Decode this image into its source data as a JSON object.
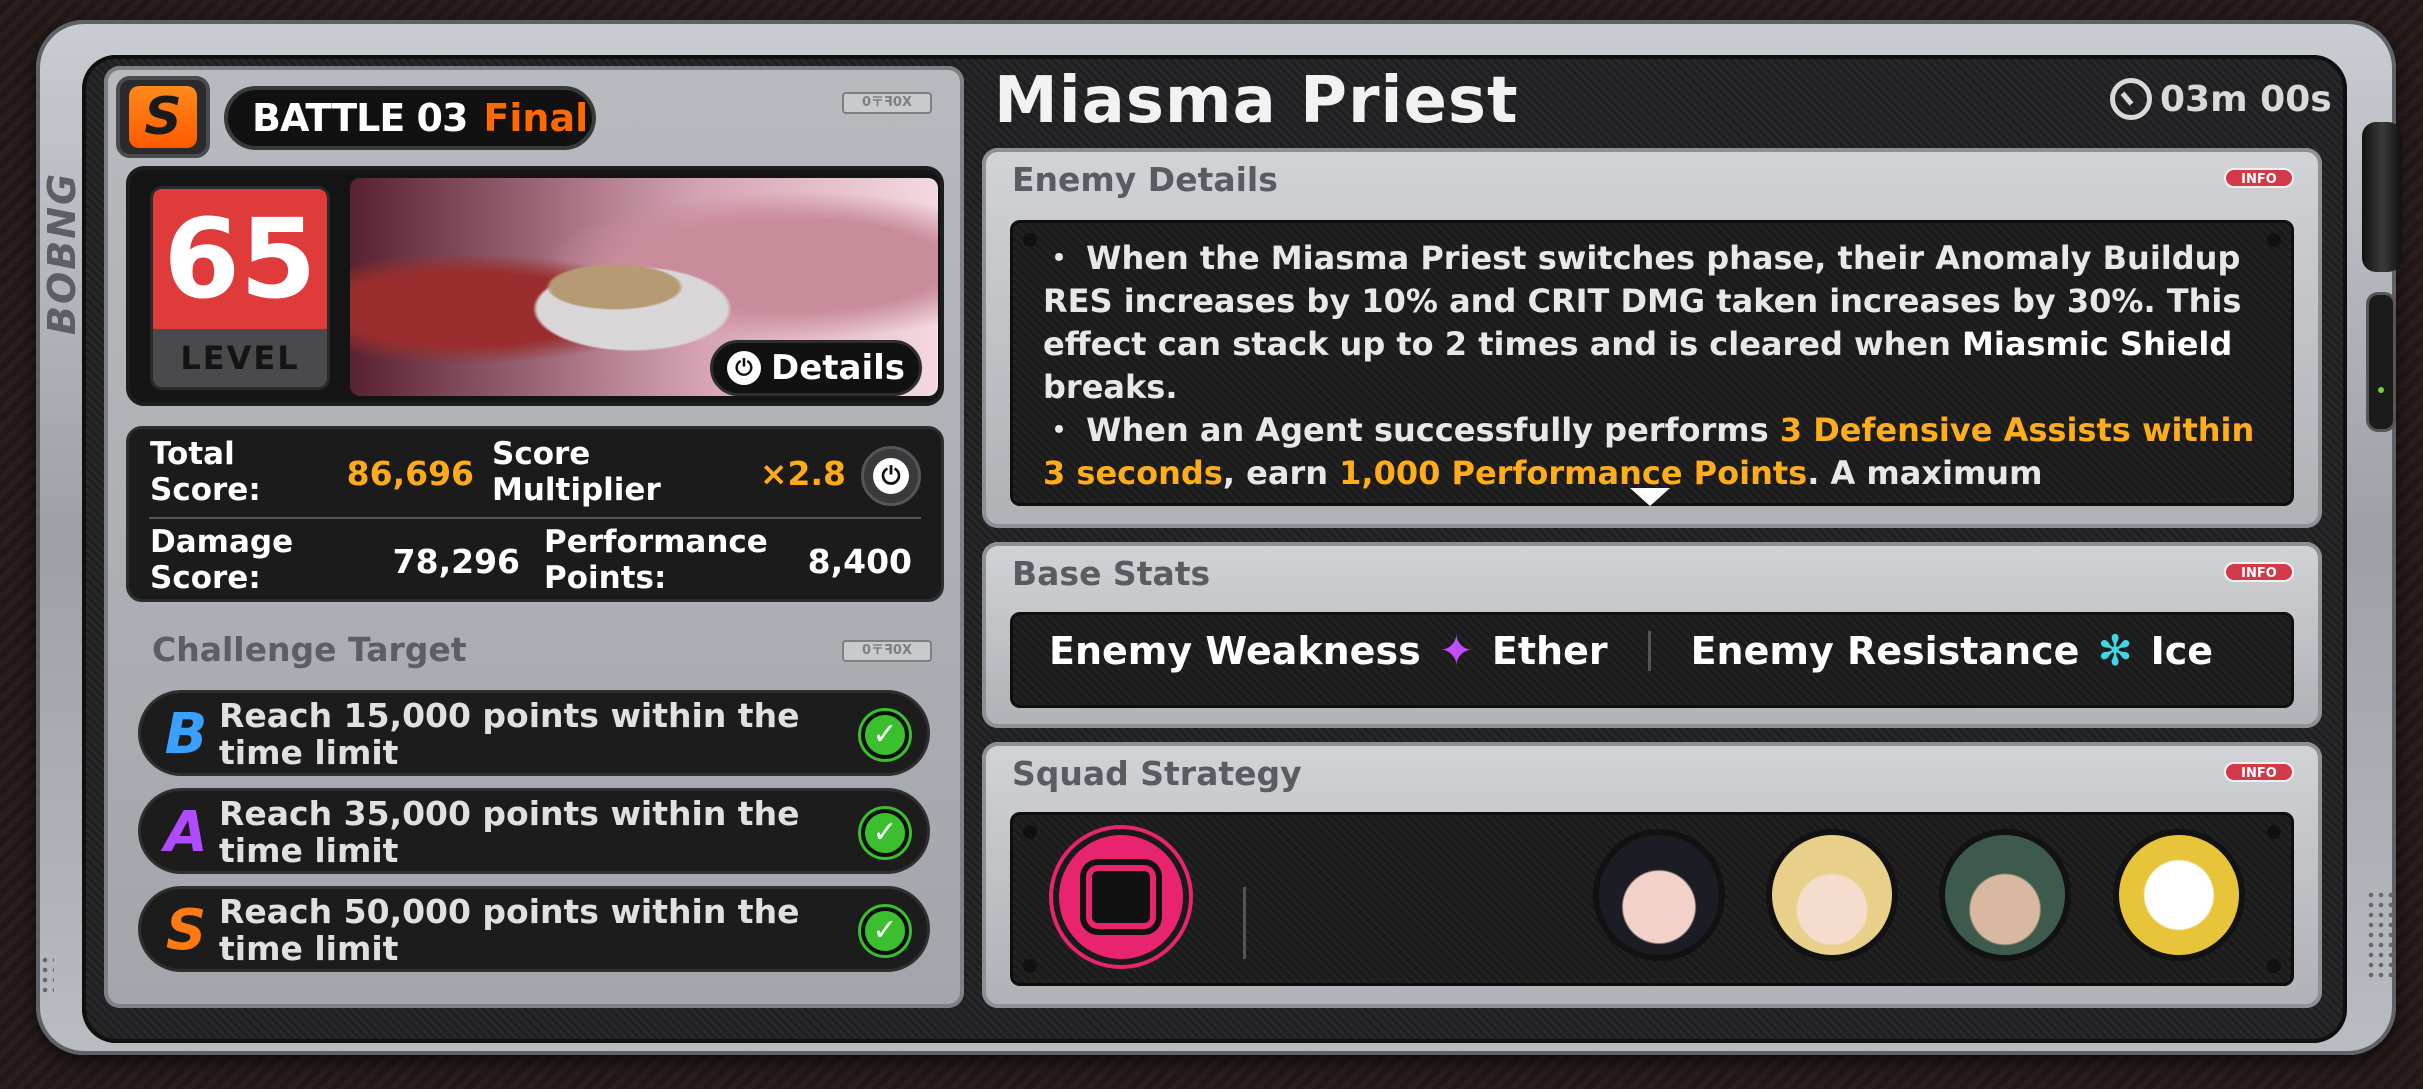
{
  "device_side_text": "BOBNG",
  "battle": {
    "rank": "S",
    "title": "BATTLE 03",
    "stage": "Final",
    "level_number": "65",
    "level_label": "LEVEL",
    "details_label": "Details",
    "tag_text": "0〒ꟻ0X"
  },
  "score": {
    "total_label": "Total Score:",
    "total_value": "86,696",
    "multiplier_label": "Score Multiplier",
    "multiplier_value": "×2.8",
    "damage_label": "Damage Score:",
    "damage_value": "78,296",
    "performance_label": "Performance Points:",
    "performance_value": "8,400"
  },
  "challenge": {
    "title": "Challenge Target",
    "targets": [
      {
        "grade": "B",
        "text": "Reach 15,000 points within the time limit",
        "color": "#3aa0ff",
        "completed": true
      },
      {
        "grade": "A",
        "text": "Reach 35,000 points within the time limit",
        "color": "#b04bff",
        "completed": true
      },
      {
        "grade": "S",
        "text": "Reach 50,000 points within the time limit",
        "color": "#ff7a12",
        "completed": true
      }
    ]
  },
  "enemy": {
    "name": "Miasma Priest",
    "timer": "03m 00s",
    "details_title": "Enemy Details",
    "info_label": "INFO",
    "desc1_a": "When the Miasma Priest switches phase, their Anomaly Buildup RES increases by 10% and CRIT DMG taken increases by 30%. This effect can stack up to 2 times and is cleared when ",
    "desc1_b": "Miasmic Shield",
    "desc1_c": " breaks.",
    "desc2_a": "When an Agent successfully performs ",
    "desc2_b": "3 Defensive Assists within 3 seconds",
    "desc2_c": ", earn ",
    "desc2_d": "1,000 Performance Points",
    "desc2_e": ". A maximum"
  },
  "base_stats": {
    "title": "Base Stats",
    "weakness_label": "Enemy Weakness",
    "weakness_value": "Ether",
    "resistance_label": "Enemy Resistance",
    "resistance_value": "Ice"
  },
  "squad": {
    "title": "Squad Strategy"
  },
  "colors": {
    "accent_orange": "#ff6a00",
    "highlight": "#ffad1a",
    "level_red": "#e03b3b",
    "check_green": "#3bbf2f"
  }
}
